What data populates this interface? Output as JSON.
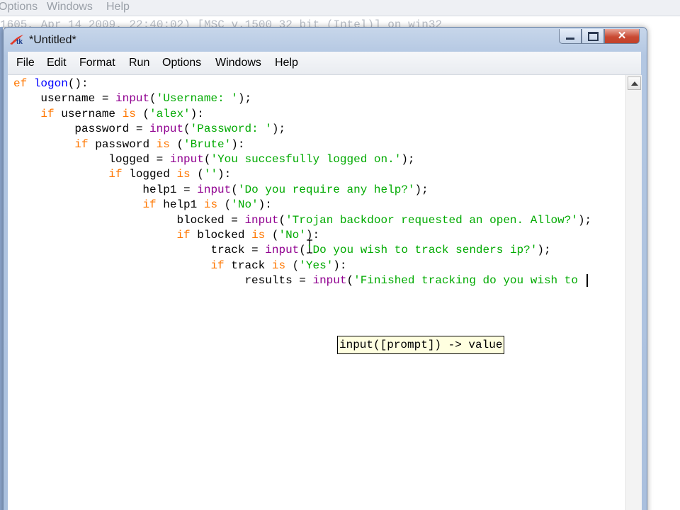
{
  "background_window": {
    "menu": [
      "Options",
      "Windows",
      "Help"
    ],
    "code_fragment": "1605, Apr 14 2009, 22:40:02) [MSC v.1500 32 bit (Intel)] on win32"
  },
  "window": {
    "title": "*Untitled*",
    "icon": "tk-feather-icon",
    "minimize": "minimize-icon",
    "maximize": "maximize-icon",
    "close": "close-icon"
  },
  "menu": {
    "items": [
      "File",
      "Edit",
      "Format",
      "Run",
      "Options",
      "Windows",
      "Help"
    ]
  },
  "editor": {
    "lines": [
      [
        {
          "t": "ef",
          "c": "kw"
        },
        {
          "t": " "
        },
        {
          "t": "logon",
          "c": "df"
        },
        {
          "t": "():"
        }
      ],
      [
        {
          "t": "    username = "
        },
        {
          "t": "input",
          "c": "bi"
        },
        {
          "t": "("
        },
        {
          "t": "'Username: '",
          "c": "st"
        },
        {
          "t": ");"
        }
      ],
      [
        {
          "t": "    "
        },
        {
          "t": "if",
          "c": "kw"
        },
        {
          "t": " username "
        },
        {
          "t": "is",
          "c": "kw"
        },
        {
          "t": " ("
        },
        {
          "t": "'alex'",
          "c": "st"
        },
        {
          "t": "):"
        }
      ],
      [
        {
          "t": "         password = "
        },
        {
          "t": "input",
          "c": "bi"
        },
        {
          "t": "("
        },
        {
          "t": "'Password: '",
          "c": "st"
        },
        {
          "t": ");"
        }
      ],
      [
        {
          "t": "         "
        },
        {
          "t": "if",
          "c": "kw"
        },
        {
          "t": " password "
        },
        {
          "t": "is",
          "c": "kw"
        },
        {
          "t": " ("
        },
        {
          "t": "'Brute'",
          "c": "st"
        },
        {
          "t": "):"
        }
      ],
      [
        {
          "t": "              logged = "
        },
        {
          "t": "input",
          "c": "bi"
        },
        {
          "t": "("
        },
        {
          "t": "'You succesfully logged on.'",
          "c": "st"
        },
        {
          "t": ");"
        }
      ],
      [
        {
          "t": "              "
        },
        {
          "t": "if",
          "c": "kw"
        },
        {
          "t": " logged "
        },
        {
          "t": "is",
          "c": "kw"
        },
        {
          "t": " ("
        },
        {
          "t": "''",
          "c": "st"
        },
        {
          "t": "):"
        }
      ],
      [
        {
          "t": "                   help1 = "
        },
        {
          "t": "input",
          "c": "bi"
        },
        {
          "t": "("
        },
        {
          "t": "'Do you require any help?'",
          "c": "st"
        },
        {
          "t": ");"
        }
      ],
      [
        {
          "t": "                   "
        },
        {
          "t": "if",
          "c": "kw"
        },
        {
          "t": " help1 "
        },
        {
          "t": "is",
          "c": "kw"
        },
        {
          "t": " ("
        },
        {
          "t": "'No'",
          "c": "st"
        },
        {
          "t": "):"
        }
      ],
      [
        {
          "t": "                        blocked = "
        },
        {
          "t": "input",
          "c": "bi"
        },
        {
          "t": "("
        },
        {
          "t": "'Trojan backdoor requested an open. Allow?'",
          "c": "st"
        },
        {
          "t": ");"
        }
      ],
      [
        {
          "t": "                        "
        },
        {
          "t": "if",
          "c": "kw"
        },
        {
          "t": " blocked "
        },
        {
          "t": "is",
          "c": "kw"
        },
        {
          "t": " ("
        },
        {
          "t": "'No'",
          "c": "st"
        },
        {
          "t": "):"
        }
      ],
      [
        {
          "t": "                             track = "
        },
        {
          "t": "input",
          "c": "bi"
        },
        {
          "t": "("
        },
        {
          "t": "'Do you wish to track senders ip?'",
          "c": "st"
        },
        {
          "t": ");"
        }
      ],
      [
        {
          "t": "                             "
        },
        {
          "t": "if",
          "c": "kw"
        },
        {
          "t": " track "
        },
        {
          "t": "is",
          "c": "kw"
        },
        {
          "t": " ("
        },
        {
          "t": "'Yes'",
          "c": "st"
        },
        {
          "t": "):"
        }
      ],
      [
        {
          "t": "                                  results = "
        },
        {
          "t": "input",
          "c": "bi"
        },
        {
          "t": "("
        },
        {
          "t": "'Finished tracking do you wish to ",
          "c": "st"
        }
      ]
    ],
    "calltip": "input([prompt]) -> value"
  },
  "colors": {
    "keyword": "#ff7700",
    "builtin": "#900090",
    "string": "#00aa00",
    "definition": "#0000ff"
  }
}
